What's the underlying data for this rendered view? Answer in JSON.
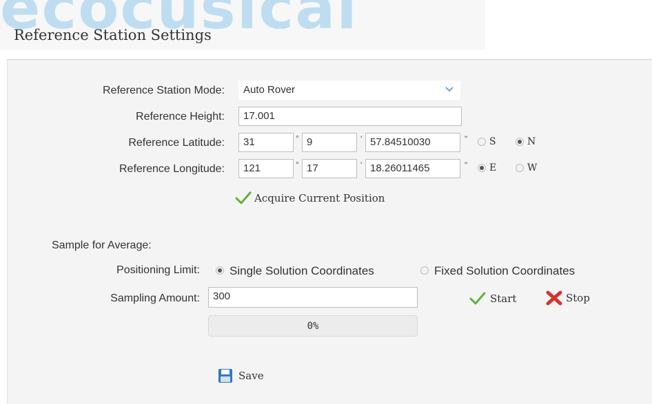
{
  "watermark": "ecocusical",
  "page": {
    "title": "Reference Station Settings"
  },
  "form": {
    "mode": {
      "label": "Reference Station Mode:",
      "value": "Auto Rover"
    },
    "height": {
      "label": "Reference Height:",
      "value": "17.001"
    },
    "latitude": {
      "label": "Reference Latitude:",
      "degrees": "31",
      "minutes": "9",
      "seconds": "57.84510030",
      "deg_symbol": "°",
      "min_symbol": "'",
      "sec_symbol": "\"",
      "options": [
        "S",
        "N"
      ],
      "selected": "N"
    },
    "longitude": {
      "label": "Reference Longitude:",
      "degrees": "121",
      "minutes": "17",
      "seconds": "18.26011465",
      "deg_symbol": "°",
      "min_symbol": "'",
      "sec_symbol": "\"",
      "options": [
        "E",
        "W"
      ],
      "selected": "E"
    },
    "acquire_label": "Acquire Current Position"
  },
  "sample": {
    "heading": "Sample for Average:",
    "limit_label": "Positioning Limit:",
    "limit_options": [
      "Single Solution Coordinates",
      "Fixed Solution Coordinates"
    ],
    "limit_selected": "Single Solution Coordinates",
    "amount_label": "Sampling Amount:",
    "amount_value": "300",
    "start_label": "Start",
    "stop_label": "Stop",
    "progress_value": 0,
    "progress_text": "0%"
  },
  "save_label": "Save",
  "icons": {
    "dropdown": "chevron-down-icon",
    "acquire": "check-icon",
    "start": "check-icon",
    "stop": "x-icon",
    "save": "floppy-disk-icon"
  },
  "colors": {
    "check": "#5fb336",
    "stop": "#d8312a",
    "save": "#2f78c4",
    "chevron": "#5aa0d8",
    "progress_fill": "#8fc1e8"
  }
}
